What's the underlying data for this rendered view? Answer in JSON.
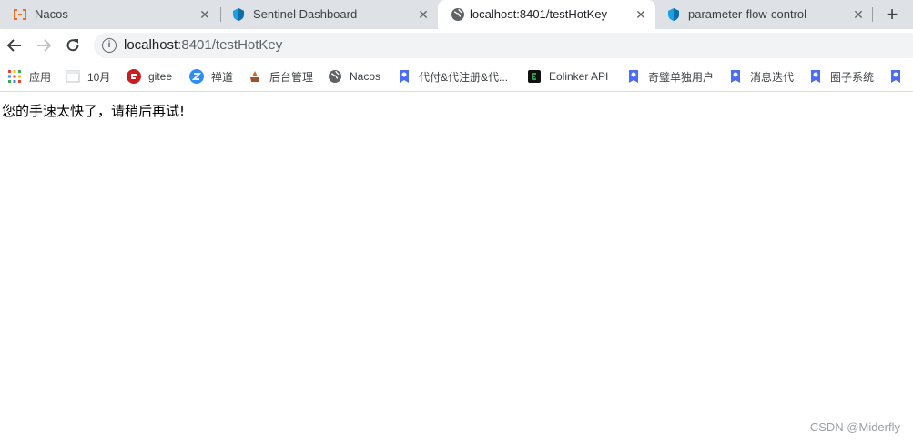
{
  "tabs": [
    {
      "title": "Nacos",
      "icon": "nacos-brackets-icon",
      "active": false
    },
    {
      "title": "Sentinel Dashboard",
      "icon": "sentinel-shield-icon",
      "active": false
    },
    {
      "title": "localhost:8401/testHotKey",
      "icon": "globe-icon",
      "active": true
    },
    {
      "title": "parameter-flow-control",
      "icon": "sentinel-shield-icon",
      "active": false
    }
  ],
  "newtab_label": "+",
  "close_glyph": "✕",
  "address": {
    "host": "localhost",
    "rest": ":8401/testHotKey"
  },
  "bookmarks": [
    {
      "label": "应用",
      "icon": "apps-grid-icon"
    },
    {
      "label": "10月",
      "icon": "page-icon"
    },
    {
      "label": "gitee",
      "icon": "gitee-icon"
    },
    {
      "label": "禅道",
      "icon": "zentao-icon"
    },
    {
      "label": "后台管理",
      "icon": "admin-icon"
    },
    {
      "label": "Nacos",
      "icon": "globe-icon"
    },
    {
      "label": "代付&代注册&代...",
      "icon": "bookmark-badge-icon"
    },
    {
      "label": "Eolinker API",
      "icon": "eolinker-icon"
    },
    {
      "label": "奇璧单独用户",
      "icon": "bookmark-badge-icon"
    },
    {
      "label": "消息迭代",
      "icon": "bookmark-badge-icon"
    },
    {
      "label": "圈子系统",
      "icon": "bookmark-badge-icon"
    }
  ],
  "page": {
    "message": "您的手速太快了，请稍后再试!"
  },
  "watermark": "CSDN @Miderfly",
  "colors": {
    "tabstrip": "#dee1e6",
    "omnibox": "#f1f3f4",
    "sentinel": "#1ba1e2",
    "nacos": "#f36d21",
    "gitee": "#c71d23",
    "zentao": "#2f8ef5",
    "badge": "#4a6cf7"
  }
}
